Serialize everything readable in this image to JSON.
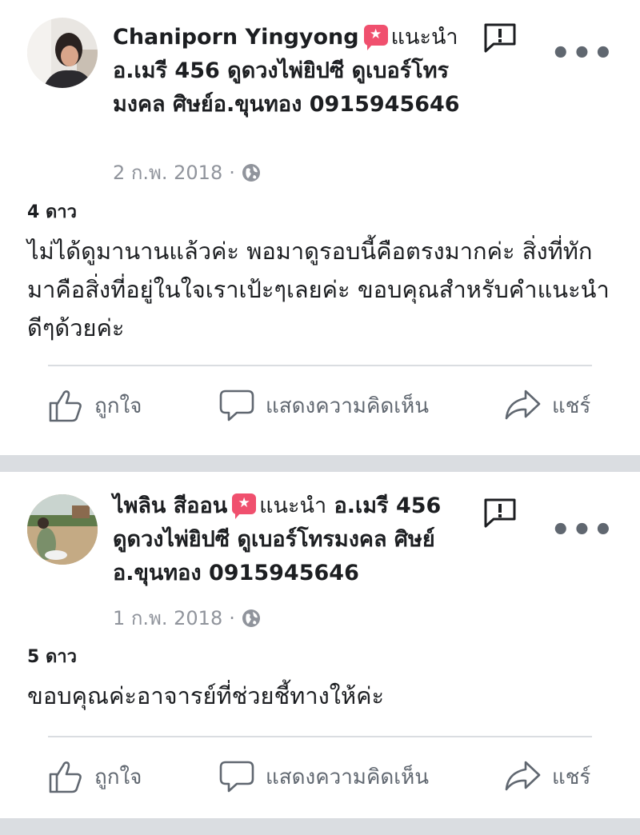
{
  "reviews": [
    {
      "reviewer_name": "Chaniporn Yingyong",
      "recommends_label": "แนะนำ",
      "page_name": "อ.เมรี 456 ดูดวงไพ่ยิปซี ดูเบอร์โทรมงคล ศิษย์อ.ขุนทอง 0915945646",
      "date": "2 ก.พ. 2018",
      "dot": "·",
      "rating": "4 ดาว",
      "text": "ไม่ได้ดูมานานแล้วค่ะ พอมาดูรอบนี้คือตรงมากค่ะ สิ่งที่ทักมาคือสิ่งที่อยู่ในใจเราเป้ะๆเลยค่ะ ขอบคุณสำหรับคำแนะนำดีๆด้วยค่ะ"
    },
    {
      "reviewer_name": "ไพลิน สีออน",
      "recommends_label": "แนะนำ",
      "page_name": "อ.เมรี 456 ดูดวงไพ่ยิปซี ดูเบอร์โทรมงคล ศิษย์อ.ขุนทอง 0915945646",
      "date": "1 ก.พ. 2018",
      "dot": "·",
      "rating": "5 ดาว",
      "text": "ขอบคุณค่ะอาจารย์ที่ช่วยชี้ทางให้ค่ะ"
    }
  ],
  "actions": {
    "like": "ถูกใจ",
    "comment": "แสดงความคิดเห็น",
    "share": "แชร์"
  },
  "more_glyph": "•••",
  "badge_glyph": "★",
  "colors": {
    "recommend_badge": "#f0506e",
    "meta_text": "#90949c",
    "action_text": "#606770",
    "section_divider": "#dadde1"
  },
  "icons": [
    "report-icon",
    "more-options-icon",
    "recommend-badge-icon",
    "globe-icon",
    "like-icon",
    "comment-icon",
    "share-icon"
  ]
}
